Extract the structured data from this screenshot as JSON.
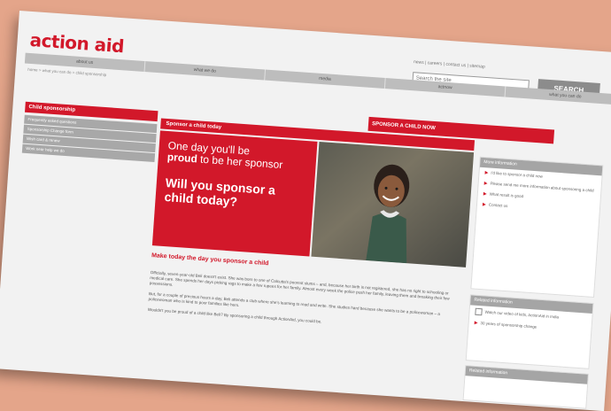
{
  "logo": "action aid",
  "utility_links": "news | careers | contact us | sitemap",
  "search": {
    "placeholder": "Search the site",
    "button": "SEARCH"
  },
  "nav": [
    "about us",
    "what we do",
    "media",
    "actnow",
    "what you can do"
  ],
  "breadcrumb": "home > what you can do > child sponsorship",
  "sponsor_banner": "SPONSOR A CHILD NOW",
  "left_header": "Child sponsorship",
  "left_nav": [
    "Frequently asked questions",
    "Sponsorship Change form",
    "Wish card & renew",
    "Work near help we do"
  ],
  "main_header": "Sponsor a child today",
  "hero": {
    "line1": "One day you'll be",
    "line2_bold": "proud",
    "line2_rest": " to be her sponsor",
    "question": "Will you sponsor a child today?"
  },
  "main_subheading": "Make today the day you sponsor a child",
  "main_body": [
    "Officially, seven-year-old Beli doesn't exist. She was born to one of Calcutta's poorest slums – and, because her birth is not registered, she has no right to schooling or medical care. She spends her days picking rags to make a few rupees for her family. Almost every week the police push her family, leaving them and breaking their few possessions.",
    "But, for a couple of precious hours a day, Beli attends a club where she's learning to read and write. She studies hard because she wants to be a policewoman – a policewoman who is kind to poor families like hers.",
    "Wouldn't you be proud of a child like Beli? By sponsoring a child through ActionAid, you could be."
  ],
  "side_box_1": {
    "header": "More information",
    "items": [
      "I'd like to sponsor a child now",
      "Please send me more information about sponsoring a child",
      "What result is good",
      "Contact us"
    ]
  },
  "side_box_2": {
    "header": "Related information",
    "items": [
      "Watch our video of kids, ActionAid in India",
      "30 years of sponsorship change"
    ]
  },
  "side_box_3": {
    "header": "Related information"
  }
}
